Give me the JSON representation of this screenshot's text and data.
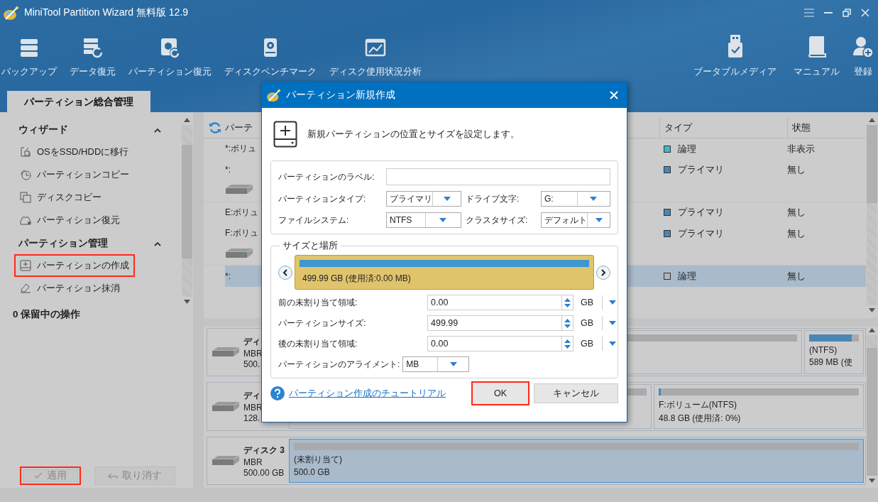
{
  "window": {
    "title": "MiniTool Partition Wizard 無料版 12.9"
  },
  "toolbar": {
    "left": [
      {
        "label": "バックアップ"
      },
      {
        "label": "データ復元"
      },
      {
        "label": "パーティション復元"
      },
      {
        "label": "ディスクベンチマーク"
      },
      {
        "label": "ディスク使用状況分析"
      }
    ],
    "right": [
      {
        "label": "ブータブルメディア"
      },
      {
        "label": "マニュアル"
      },
      {
        "label": "登録"
      }
    ]
  },
  "tabs": [
    {
      "label": "パーティション総合管理",
      "selected": true
    }
  ],
  "sidebar": {
    "sections": [
      {
        "title": "ウィザード",
        "expanded": true,
        "items": [
          {
            "label": "OSをSSD/HDDに移行",
            "highlighted": false
          },
          {
            "label": "パーティションコピー",
            "highlighted": false
          },
          {
            "label": "ディスクコピー",
            "highlighted": false
          },
          {
            "label": "パーティション復元",
            "highlighted": false
          }
        ]
      },
      {
        "title": "パーティション管理",
        "expanded": true,
        "items": [
          {
            "label": "パーティションの作成",
            "highlighted": true
          },
          {
            "label": "パーティション抹消",
            "highlighted": false
          }
        ]
      }
    ],
    "pending": "0 保留中の操作",
    "buttons": [
      {
        "label": "適用",
        "disabled": true,
        "highlighted": true
      },
      {
        "label": "取り消す",
        "disabled": true,
        "highlighted": false
      }
    ]
  },
  "partition_table": {
    "columns": [
      "パーテ",
      "タイプ",
      "状態"
    ],
    "rows": [
      {
        "kind": "partition",
        "partition": "*:ボリュ",
        "type": "論理",
        "color": "#3fb6c8",
        "status": "非表示",
        "selected": false
      },
      {
        "kind": "partition",
        "partition": "*:",
        "type": "プライマリ",
        "color": "#4a86b4",
        "status": "無し",
        "selected": false
      },
      {
        "kind": "disk"
      },
      {
        "kind": "partition",
        "partition": "E:ボリュ",
        "type": "プライマリ",
        "color": "#4a86b4",
        "status": "無し",
        "selected": false
      },
      {
        "kind": "partition",
        "partition": "F:ボリュ",
        "type": "プライマリ",
        "color": "#4a86b4",
        "status": "無し",
        "selected": false
      },
      {
        "kind": "disk"
      },
      {
        "kind": "partition",
        "partition": "*:",
        "type": "論理",
        "color": "#b4b4b4",
        "status": "無し",
        "selected": true
      }
    ]
  },
  "disk_map": {
    "disks": [
      {
        "name": "ディ",
        "scheme": "MBR",
        "size": "500.",
        "partitions": [
          {
            "level": 0,
            "selected": false
          },
          {
            "label": "(NTFS)",
            "size": "589 MB (使",
            "level": 0.86,
            "selected": false
          }
        ]
      },
      {
        "name": "ディ",
        "scheme": "MBR",
        "size": "128.",
        "partitions": [
          {
            "level": 0,
            "selected": false
          },
          {
            "label": "F:ボリューム(NTFS)",
            "size": "48.8 GB (使用済: 0%)",
            "level": 0.01,
            "selected": false
          }
        ]
      },
      {
        "name": "ディスク 3",
        "scheme": "MBR",
        "size": "500.00 GB",
        "partitions": [
          {
            "label": "(未割り当て)",
            "size": "500.0 GB",
            "level": 0,
            "selected": true
          }
        ]
      }
    ]
  },
  "dialog": {
    "title": "パーティション新規作成",
    "intro": "新規パーティションの位置とサイズを設定します。",
    "label_field": {
      "label": "パーティションのラベル:"
    },
    "selects": [
      {
        "label": "パーティションタイプ:",
        "value": "プライマリ"
      },
      {
        "label": "ドライブ文字:",
        "value": "G:"
      },
      {
        "label": "ファイルシステム:",
        "value": "NTFS"
      },
      {
        "label": "クラスタサイズ:",
        "value": "デフォルト"
      }
    ],
    "size_group": {
      "title": "サイズと場所",
      "bar_text": "499.99 GB (使用済:0.00 MB)"
    },
    "spinners": [
      {
        "label": "前の未割り当て領域:",
        "value": "0.00",
        "unit": "GB"
      },
      {
        "label": "パーティションサイズ:",
        "value": "499.99",
        "unit": "GB"
      },
      {
        "label": "後の未割り当て領域:",
        "value": "0.00",
        "unit": "GB"
      }
    ],
    "alignment": {
      "label": "パーティションのアライメント:",
      "value": "MB"
    },
    "help_link": "パーティション作成のチュートリアル",
    "buttons": [
      {
        "label": "OK",
        "highlighted": true
      },
      {
        "label": "キャンセル",
        "highlighted": false
      }
    ]
  }
}
